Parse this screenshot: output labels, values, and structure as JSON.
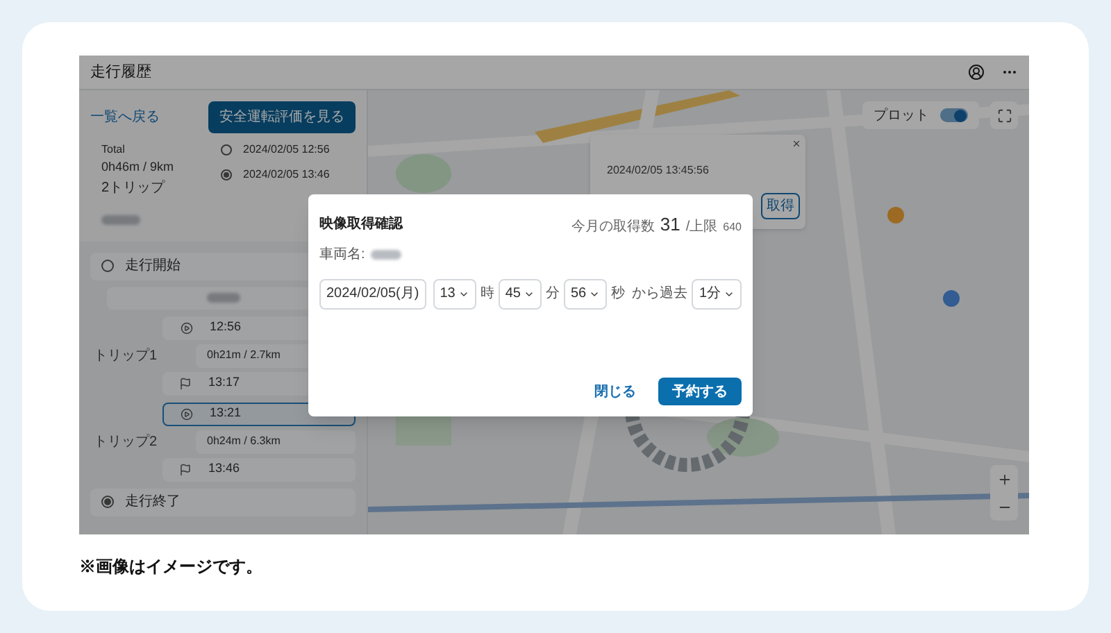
{
  "app": {
    "title": "走行履歴",
    "back_link": "一覧へ戻る",
    "eval_button": "安全運転評価を見る",
    "summary": {
      "total_label": "Total",
      "total": "0h46m / 9km",
      "trip_count": "2トリップ"
    },
    "timeline": [
      {
        "time": "2024/02/05 12:56",
        "kind": "start"
      },
      {
        "time": "2024/02/05 13:46",
        "kind": "end"
      }
    ],
    "start_label": "走行開始",
    "end_label": "走行終了",
    "trips": [
      {
        "label": "トリップ1",
        "start": "12:56",
        "distance": "0h21m / 2.7km",
        "end": "13:17",
        "selected": false
      },
      {
        "label": "トリップ2",
        "start": "13:21",
        "distance": "0h24m / 6.3km",
        "end": "13:46",
        "selected": true
      }
    ],
    "map": {
      "plot_label": "プロット",
      "plot_on": true,
      "popup": {
        "time": "2024/02/05 13:45:56",
        "button": "取得"
      }
    },
    "modal": {
      "title": "映像取得確認",
      "count_label": "今月の取得数",
      "count": "31",
      "limit_label": "/上限",
      "limit": "640",
      "vehicle_label": "車両名:",
      "date": "2024/02/05(月)",
      "time_fields": [
        {
          "value": "13",
          "unit": "時"
        },
        {
          "value": "45",
          "unit": "分"
        },
        {
          "value": "56",
          "unit": "秒"
        }
      ],
      "range_label": "から過去",
      "duration": "1分",
      "buttons": [
        {
          "label": "閉じる",
          "kind": "text"
        },
        {
          "label": "予約する",
          "kind": "primary"
        }
      ]
    }
  },
  "caption": "※画像はイメージです。"
}
